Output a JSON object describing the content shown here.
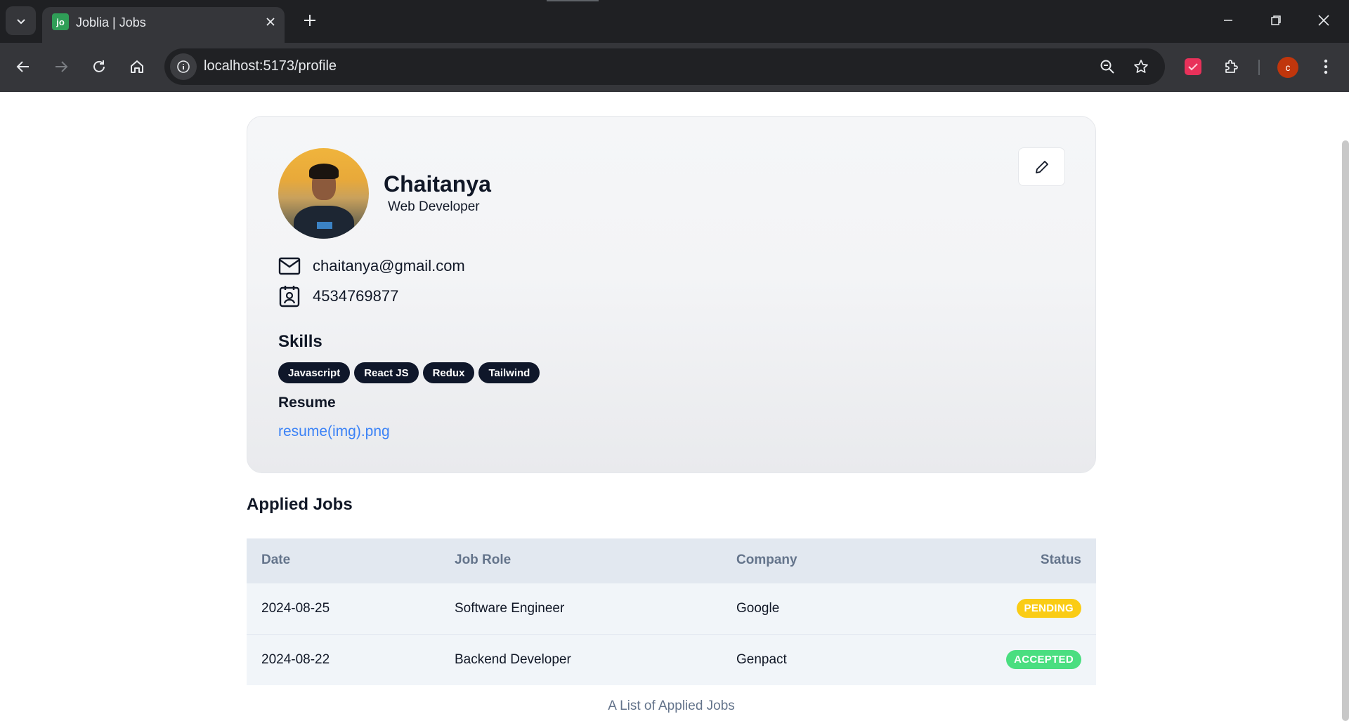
{
  "browser": {
    "tab": {
      "favicon_text": "jo",
      "title": "Joblia | Jobs"
    },
    "url": "localhost:5173/profile",
    "profile_initial": "c"
  },
  "profile": {
    "name": "Chaitanya",
    "role": "Web Developer",
    "email": "chaitanya@gmail.com",
    "phone": "4534769877",
    "skills_title": "Skills",
    "skills": [
      "Javascript",
      "React JS",
      "Redux",
      "Tailwind"
    ],
    "resume_title": "Resume",
    "resume_file": "resume(img).png"
  },
  "applied_jobs": {
    "title": "Applied Jobs",
    "headers": [
      "Date",
      "Job Role",
      "Company",
      "Status"
    ],
    "rows": [
      {
        "date": "2024-08-25",
        "role": "Software Engineer",
        "company": "Google",
        "status": "PENDING"
      },
      {
        "date": "2024-08-22",
        "role": "Backend Developer",
        "company": "Genpact",
        "status": "ACCEPTED"
      }
    ],
    "caption": "A List of Applied Jobs"
  },
  "colors": {
    "pending": "#facc15",
    "accepted": "#4ade80",
    "link": "#3b82f6",
    "badge_bg": "#0f172a"
  }
}
